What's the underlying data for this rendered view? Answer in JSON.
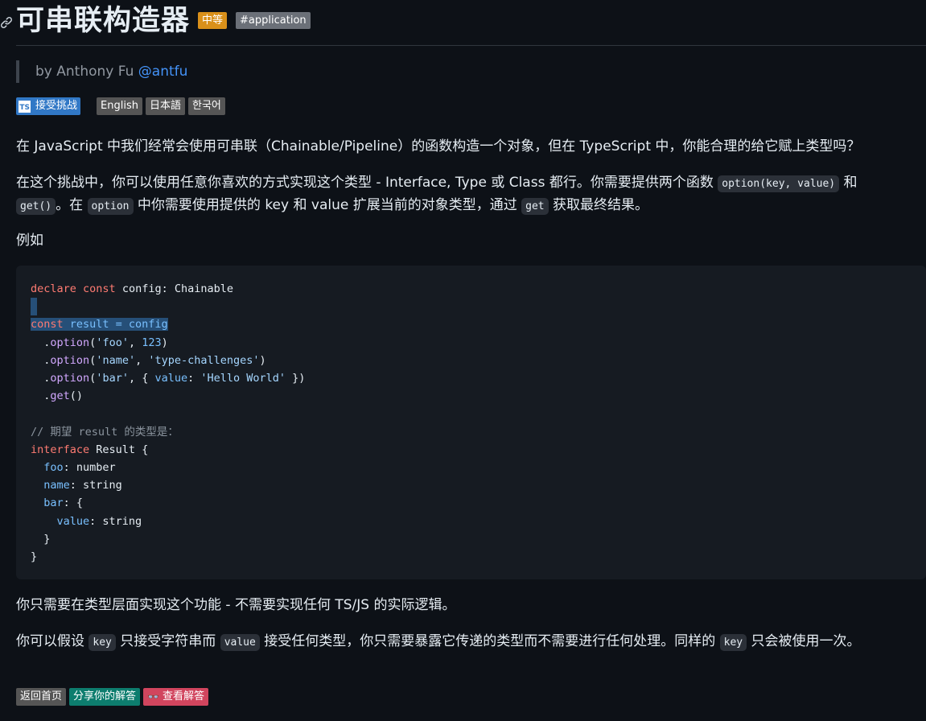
{
  "header": {
    "title": "可串联构造器",
    "difficulty": "中等",
    "tag": "#application"
  },
  "author": {
    "prefix": "by Anthony Fu",
    "handle": "@antfu"
  },
  "badges": {
    "take_challenge": "接受挑战",
    "ts_logo": "TS",
    "languages": [
      "English",
      "日本語",
      "한국어"
    ]
  },
  "content": {
    "p1": "在 JavaScript 中我们经常会使用可串联（Chainable/Pipeline）的函数构造一个对象，但在 TypeScript 中，你能合理的给它赋上类型吗？",
    "p2_a": "在这个挑战中，你可以使用任意你喜欢的方式实现这个类型 - Interface, Type 或 Class 都行。你需要提供两个函数 ",
    "p2_code1": "option(key, value)",
    "p2_b": " 和 ",
    "p2_code2": "get()",
    "p2_c": "。在 ",
    "p2_code3": "option",
    "p2_d": " 中你需要使用提供的 key 和 value 扩展当前的对象类型，通过 ",
    "p2_code4": "get",
    "p2_e": " 获取最终结果。",
    "p3": "例如",
    "p4": "你只需要在类型层面实现这个功能 - 不需要实现任何 TS/JS 的实际逻辑。",
    "p5_a": "你可以假设 ",
    "p5_code1": "key",
    "p5_b": " 只接受字符串而 ",
    "p5_code2": "value",
    "p5_c": " 接受任何类型，你只需要暴露它传递的类型而不需要进行任何处理。同样的 ",
    "p5_code3": "key",
    "p5_d": " 只会被使用一次。"
  },
  "code": {
    "l1_kw1": "declare",
    "l1_kw2": "const",
    "l1_rest": " config: Chainable",
    "l3_kw": "const",
    "l3_rest": " result = config",
    "l4_fn": "option",
    "l4_str": "'foo'",
    "l4_num": "123",
    "l5_fn": "option",
    "l5_str1": "'name'",
    "l5_str2": "'type-challenges'",
    "l6_fn": "option",
    "l6_str1": "'bar'",
    "l6_prop": "value",
    "l6_str2": "'Hello World'",
    "l7_fn": "get",
    "l9_cmt": "// 期望 result 的类型是：",
    "l10_kw": "interface",
    "l10_rest": " Result {",
    "l11_prop": "foo",
    "l11_ty": ": number",
    "l12_prop": "name",
    "l12_ty": ": string",
    "l13_prop": "bar",
    "l13_ty": ": {",
    "l14_prop": "value",
    "l14_ty": ": string"
  },
  "footer": {
    "back": "返回首页",
    "share": "分享你的解答",
    "solutions": "查看解答"
  },
  "colors": {
    "background": "#0d1117",
    "medium_badge": "#d9901a",
    "link": "#4493f8",
    "ts_blue": "#3178c6",
    "share": "#0d7d6e",
    "solutions": "#d1455e"
  }
}
